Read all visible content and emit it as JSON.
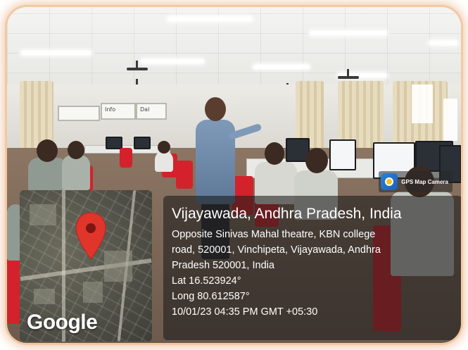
{
  "gps_badge": {
    "label": "GPS Map Camera",
    "icon": "gps-map-camera-icon"
  },
  "map": {
    "provider": "Google",
    "pin_icon": "location-pin-icon",
    "pin_color": "#e0352b"
  },
  "location": {
    "title": "Vijayawada, Andhra Pradesh, India",
    "address_lines": [
      "Opposite Sinivas Mahal theatre, KBN college",
      "road, 520001, Vinchipeta, Vijayawada, Andhra",
      "Pradesh 520001, India"
    ],
    "lat": "Lat 16.523924°",
    "long": "Long 80.612587°",
    "timestamp": "10/01/23 04:35 PM GMT +05:30"
  },
  "scene": {
    "boards": [
      "Info",
      "Dal"
    ]
  },
  "colors": {
    "frame_glow": "#f2c9a2",
    "chair": "#d3222b",
    "overlay": "#191919"
  }
}
